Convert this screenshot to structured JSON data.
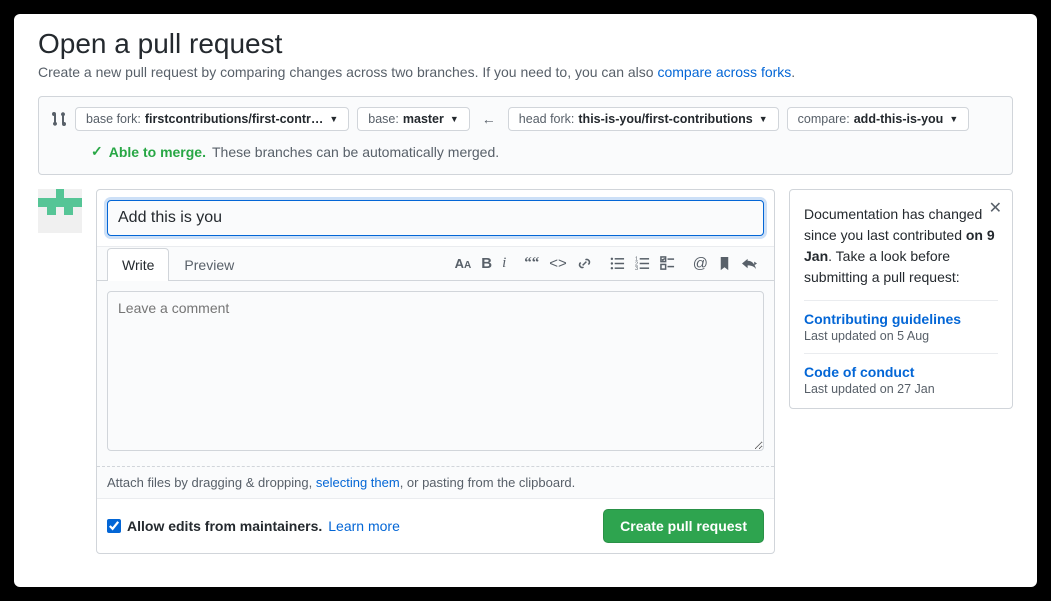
{
  "header": {
    "title": "Open a pull request",
    "subhead_pre": "Create a new pull request by comparing changes across two branches. If you need to, you can also ",
    "subhead_link": "compare across forks",
    "subhead_post": "."
  },
  "compare": {
    "base_fork_label": "base fork: ",
    "base_fork_value": "firstcontributions/first-contr…",
    "base_label": "base: ",
    "base_value": "master",
    "head_fork_label": "head fork: ",
    "head_fork_value": "this-is-you/first-contributions",
    "compare_label": "compare: ",
    "compare_value": "add-this-is-you",
    "able_label": "Able to merge.",
    "able_desc": "These branches can be automatically merged."
  },
  "pr": {
    "title_value": "Add this is you",
    "tab_write": "Write",
    "tab_preview": "Preview",
    "comment_placeholder": "Leave a comment",
    "attach_pre": "Attach files by dragging & dropping, ",
    "attach_link": "selecting them",
    "attach_post": ", or pasting from the clipboard.",
    "allow_edits_label": "Allow edits from maintainers.",
    "learn_more": "Learn more",
    "submit_label": "Create pull request"
  },
  "notice": {
    "text_pre": "Documentation has changed since you last contributed ",
    "text_bold": "on 9 Jan",
    "text_post": ". Take a look before submitting a pull request:",
    "links": [
      {
        "title": "Contributing guidelines",
        "meta": "Last updated on 5 Aug"
      },
      {
        "title": "Code of conduct",
        "meta": "Last updated on 27 Jan"
      }
    ]
  }
}
